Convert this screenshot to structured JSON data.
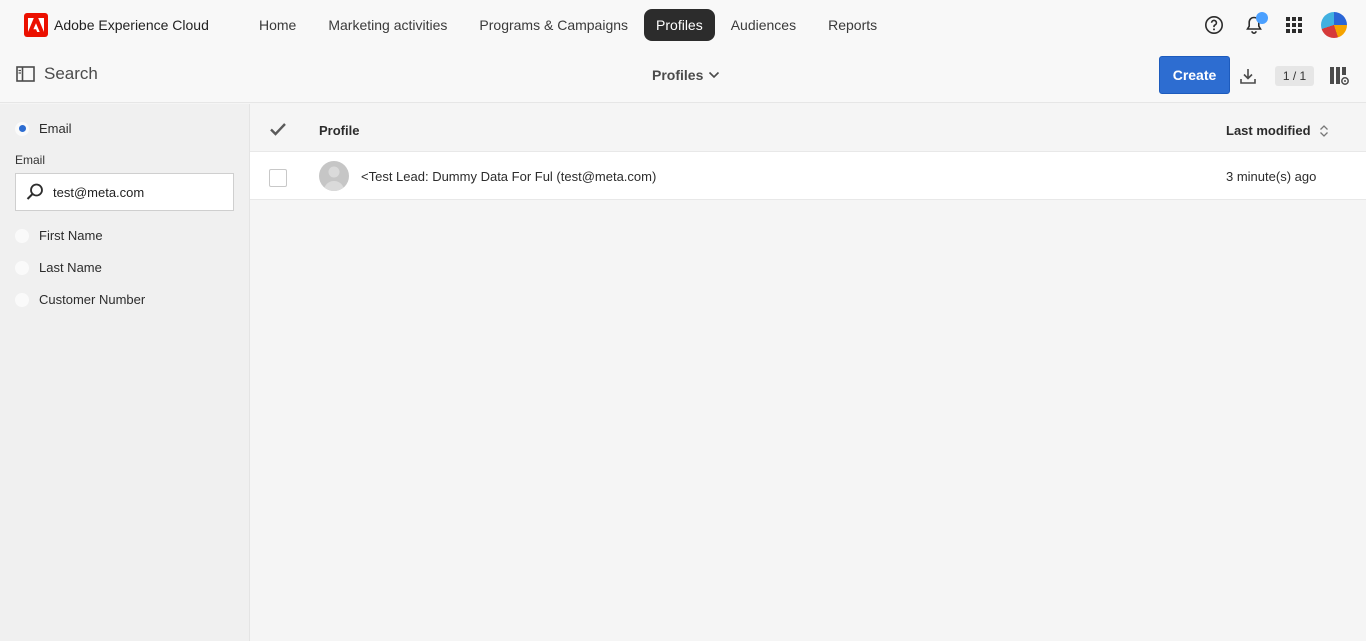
{
  "app": {
    "brand_name": "Adobe Experience Cloud"
  },
  "nav": {
    "items": [
      {
        "label": "Home"
      },
      {
        "label": "Marketing activities"
      },
      {
        "label": "Programs & Campaigns"
      },
      {
        "label": "Profiles",
        "active": true
      },
      {
        "label": "Audiences"
      },
      {
        "label": "Reports"
      }
    ]
  },
  "top_icons": [
    "help-icon",
    "bell-icon",
    "apps-grid-icon",
    "user-avatar"
  ],
  "toolbar": {
    "search_label": "Search",
    "view_label": "Profiles",
    "create_label": "Create",
    "page_count": "1 / 1"
  },
  "sidebar": {
    "options": [
      {
        "label": "Email",
        "selected": true
      },
      {
        "label": "First Name",
        "selected": false
      },
      {
        "label": "Last Name",
        "selected": false
      },
      {
        "label": "Customer Number",
        "selected": false
      }
    ],
    "field_label": "Email",
    "search_value": "test@meta.com"
  },
  "table": {
    "headers": {
      "profile": "Profile",
      "last_modified": "Last modified"
    },
    "rows": [
      {
        "name": "<Test Lead: Dummy Data For Ful (test@meta.com)",
        "modified": "3 minute(s) ago"
      }
    ]
  },
  "colors": {
    "accent": "#2d6dd1",
    "brand": "#eb1000",
    "notification": "#4ba0ff"
  }
}
